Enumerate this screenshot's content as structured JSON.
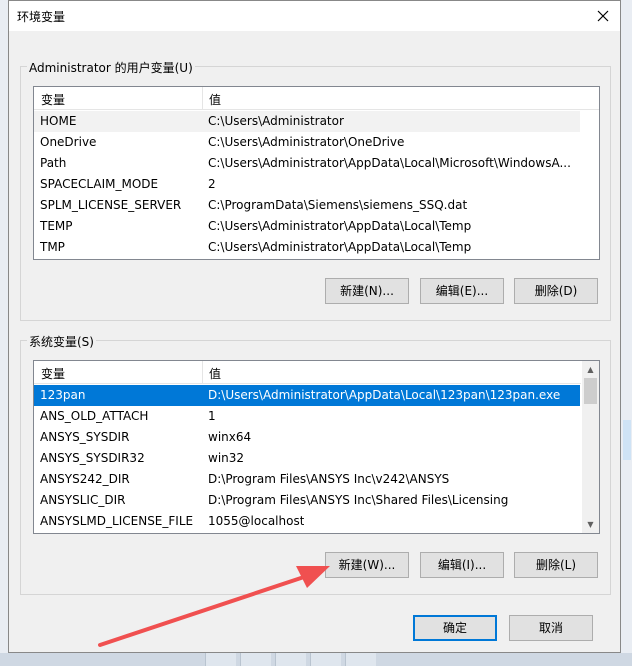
{
  "dialog": {
    "title": "环境变量",
    "close_icon": "close-icon"
  },
  "user_vars": {
    "group_label": "Administrator 的用户变量(U)",
    "headers": [
      "变量",
      "值"
    ],
    "rows": [
      {
        "name": "HOME",
        "value": "C:\\Users\\Administrator"
      },
      {
        "name": "OneDrive",
        "value": "C:\\Users\\Administrator\\OneDrive"
      },
      {
        "name": "Path",
        "value": "C:\\Users\\Administrator\\AppData\\Local\\Microsoft\\WindowsA..."
      },
      {
        "name": "SPACECLAIM_MODE",
        "value": "2"
      },
      {
        "name": "SPLM_LICENSE_SERVER",
        "value": "C:\\ProgramData\\Siemens\\siemens_SSQ.dat"
      },
      {
        "name": "TEMP",
        "value": "C:\\Users\\Administrator\\AppData\\Local\\Temp"
      },
      {
        "name": "TMP",
        "value": "C:\\Users\\Administrator\\AppData\\Local\\Temp"
      }
    ],
    "buttons": {
      "new": "新建(N)...",
      "edit": "编辑(E)...",
      "delete": "删除(D)"
    }
  },
  "system_vars": {
    "group_label": "系统变量(S)",
    "headers": [
      "变量",
      "值"
    ],
    "rows": [
      {
        "name": "123pan",
        "value": "D:\\Users\\Administrator\\AppData\\Local\\123pan\\123pan.exe"
      },
      {
        "name": "ANS_OLD_ATTACH",
        "value": "1"
      },
      {
        "name": "ANSYS_SYSDIR",
        "value": "winx64"
      },
      {
        "name": "ANSYS_SYSDIR32",
        "value": "win32"
      },
      {
        "name": "ANSYS242_DIR",
        "value": "D:\\Program Files\\ANSYS Inc\\v242\\ANSYS"
      },
      {
        "name": "ANSYSLIC_DIR",
        "value": "D:\\Program Files\\ANSYS Inc\\Shared Files\\Licensing"
      },
      {
        "name": "ANSYSLMD_LICENSE_FILE",
        "value": "1055@localhost"
      }
    ],
    "buttons": {
      "new": "新建(W)...",
      "edit": "编辑(I)...",
      "delete": "删除(L)"
    }
  },
  "footer": {
    "ok": "确定",
    "cancel": "取消"
  },
  "colors": {
    "selection": "#0078d7",
    "arrow": "#f05050"
  }
}
